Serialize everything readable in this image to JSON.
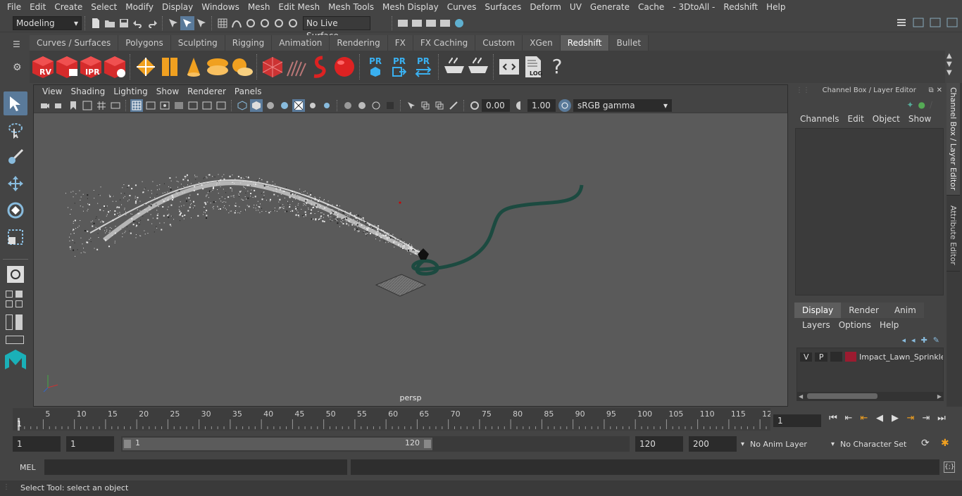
{
  "menus": [
    "File",
    "Edit",
    "Create",
    "Select",
    "Modify",
    "Display",
    "Windows",
    "Mesh",
    "Edit Mesh",
    "Mesh Tools",
    "Mesh Display",
    "Curves",
    "Surfaces",
    "Deform",
    "UV",
    "Generate",
    "Cache",
    "- 3DtoAll -",
    "Redshift",
    "Help"
  ],
  "status": {
    "mode": "Modeling",
    "live_surface": "No Live Surface"
  },
  "shelf_tabs": [
    "Curves / Surfaces",
    "Polygons",
    "Sculpting",
    "Rigging",
    "Animation",
    "Rendering",
    "FX",
    "FX Caching",
    "Custom",
    "XGen",
    "Redshift",
    "Bullet"
  ],
  "active_shelf_tab": "Redshift",
  "shelf_labels": {
    "rv": "RV",
    "ipr": "IPR",
    "pr1": "PR",
    "pr2": "PR",
    "pr3": "PR",
    "log": "LOG"
  },
  "viewport": {
    "menus": [
      "View",
      "Shading",
      "Lighting",
      "Show",
      "Renderer",
      "Panels"
    ],
    "exposure": "0.00",
    "gamma": "1.00",
    "colorspace": "sRGB gamma",
    "camera_label": "persp"
  },
  "channel_box": {
    "title": "Channel Box / Layer Editor",
    "menus": [
      "Channels",
      "Edit",
      "Object",
      "Show"
    ]
  },
  "layer_editor": {
    "tabs": [
      "Display",
      "Render",
      "Anim"
    ],
    "active_tab": "Display",
    "menus": [
      "Layers",
      "Options",
      "Help"
    ],
    "layer": {
      "v": "V",
      "p": "P",
      "name": "Impact_Lawn_Sprinkle",
      "color": "#9b1b30"
    }
  },
  "side_tabs": [
    "Channel Box / Layer Editor",
    "Attribute Editor"
  ],
  "timeline": {
    "ticks": [
      "5",
      "10",
      "15",
      "20",
      "25",
      "30",
      "35",
      "40",
      "45",
      "50",
      "55",
      "60",
      "65",
      "70",
      "75",
      "80",
      "85",
      "90",
      "95",
      "100",
      "105",
      "110",
      "115",
      "12"
    ],
    "start_label": "1",
    "current_frame": "1"
  },
  "range": {
    "start": "1",
    "start2": "1",
    "slider_start": "1",
    "slider_end": "120",
    "end": "120",
    "end2": "200",
    "anim_layer": "No Anim Layer",
    "char_set": "No Character Set"
  },
  "command": {
    "label": "MEL"
  },
  "help_line": "Select Tool: select an object"
}
